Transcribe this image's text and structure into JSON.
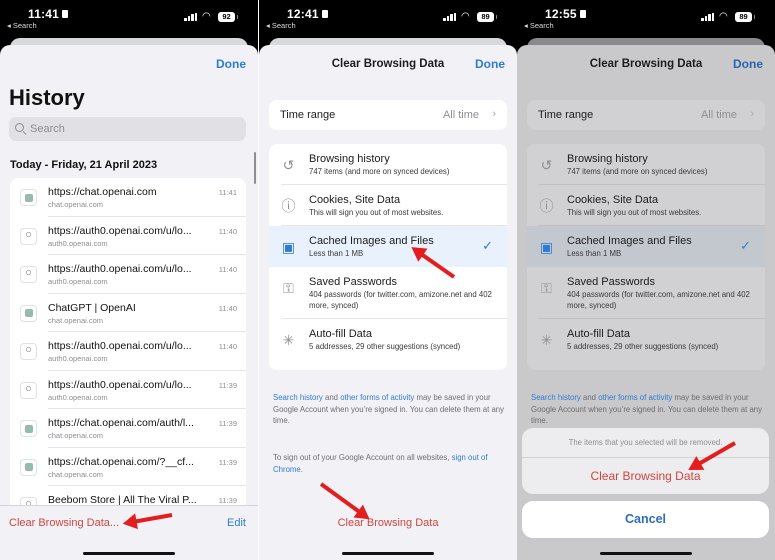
{
  "screens": [
    {
      "status": {
        "time": "11:41",
        "back_label": "◂ Search",
        "battery": "92"
      },
      "done_label": "Done",
      "title": "History",
      "search_placeholder": "Search",
      "date_header": "Today - Friday, 21 April 2023",
      "items": [
        {
          "title": "https://chat.openai.com",
          "subtitle": "chat.openai.com",
          "time": "11:41",
          "icon": "chatgpt-favicon"
        },
        {
          "title": "https://auth0.openai.com/u/lo...",
          "subtitle": "auth0.openai.com",
          "time": "11:40",
          "icon": "generic-favicon"
        },
        {
          "title": "https://auth0.openai.com/u/lo...",
          "subtitle": "auth0.openai.com",
          "time": "11:40",
          "icon": "generic-favicon"
        },
        {
          "title": "ChatGPT | OpenAI",
          "subtitle": "chat.openai.com",
          "time": "11:40",
          "icon": "chatgpt-favicon"
        },
        {
          "title": "https://auth0.openai.com/u/lo...",
          "subtitle": "auth0.openai.com",
          "time": "11:40",
          "icon": "generic-favicon"
        },
        {
          "title": "https://auth0.openai.com/u/lo...",
          "subtitle": "auth0.openai.com",
          "time": "11:39",
          "icon": "generic-favicon"
        },
        {
          "title": "https://chat.openai.com/auth/l...",
          "subtitle": "chat.openai.com",
          "time": "11:39",
          "icon": "chatgpt-favicon"
        },
        {
          "title": "https://chat.openai.com/?__cf...",
          "subtitle": "chat.openai.com",
          "time": "11:39",
          "icon": "chatgpt-favicon"
        },
        {
          "title": "Beebom Store | All The Viral P...",
          "subtitle": "",
          "time": "11:39",
          "icon": "generic-favicon"
        }
      ],
      "footer": {
        "clear_label": "Clear Browsing Data...",
        "edit_label": "Edit"
      }
    },
    {
      "status": {
        "time": "12:41",
        "back_label": "◂ Search",
        "battery": "89"
      },
      "title": "Clear Browsing Data",
      "done_label": "Done",
      "time_range": {
        "label": "Time range",
        "value": "All time"
      },
      "options": [
        {
          "title": "Browsing history",
          "subtitle": "747 items (and more on synced devices)",
          "icon": "history-icon",
          "selected": false
        },
        {
          "title": "Cookies, Site Data",
          "subtitle": "This will sign you out of most websites.",
          "icon": "info-icon",
          "selected": false
        },
        {
          "title": "Cached Images and Files",
          "subtitle": "Less than 1 MB",
          "icon": "images-icon",
          "selected": true
        },
        {
          "title": "Saved Passwords",
          "subtitle": "404 passwords (for twitter.com, amizone.net and 402 more, synced)",
          "icon": "key-icon",
          "selected": false
        },
        {
          "title": "Auto-fill Data",
          "subtitle": "5 addresses, 29 other suggestions (synced)",
          "icon": "autofill-icon",
          "selected": false
        }
      ],
      "info": {
        "link1": "Search history",
        "text1": " and ",
        "link2": "other forms of activity",
        "text2": " may be saved in your Google Account when you’re signed in. You can delete them at any time."
      },
      "info2": {
        "text": "To sign out of your Google Account on all websites, ",
        "link": "sign out of Chrome",
        "end": "."
      },
      "clear_button": "Clear Browsing Data"
    },
    {
      "status": {
        "time": "12:55",
        "back_label": "◂ Search",
        "battery": "89"
      },
      "title": "Clear Browsing Data",
      "done_label": "Done",
      "time_range": {
        "label": "Time range",
        "value": "All time"
      },
      "action_sheet": {
        "message": "The items that you selected will be removed.",
        "destructive_label": "Clear Browsing Data",
        "cancel_label": "Cancel"
      }
    }
  ],
  "colors": {
    "accent": "#2f7bd3",
    "destructive": "#d0463f",
    "annotation": "#e41e1e"
  }
}
